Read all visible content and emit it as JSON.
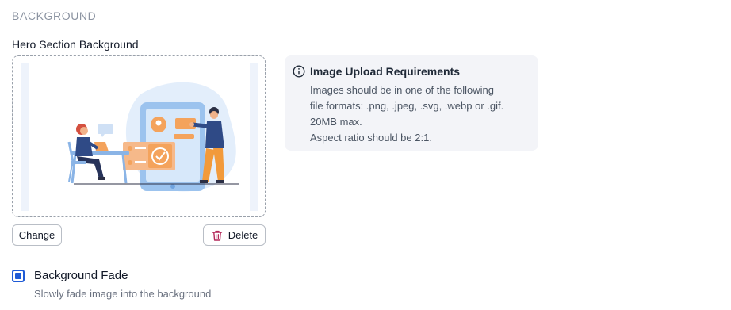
{
  "section": {
    "heading": "BACKGROUND"
  },
  "hero_background": {
    "label": "Hero Section Background",
    "image_alt": "hero-illustration",
    "change_label": "Change",
    "delete_label": "Delete"
  },
  "requirements": {
    "title": "Image Upload Requirements",
    "lines": [
      "Images should be in one of the following",
      "file formats: .png, .jpeg, .svg, .webp or .gif.",
      "20MB max.",
      "Aspect ratio should be 2:1."
    ]
  },
  "background_fade": {
    "label": "Background Fade",
    "description": "Slowly fade image into the background",
    "checked": true
  },
  "icons": {
    "info": "info-circle-icon",
    "delete": "trash-icon"
  },
  "colors": {
    "accent": "#1f5bd6",
    "danger": "#b4285a",
    "info_bg": "#f3f4f8"
  }
}
